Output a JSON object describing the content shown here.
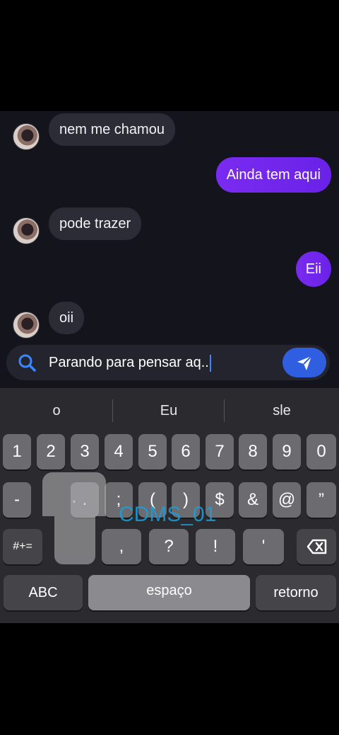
{
  "messages": [
    {
      "side": "in",
      "text": "nem me chamou"
    },
    {
      "side": "out",
      "text": "Ainda tem aqui"
    },
    {
      "side": "in",
      "text": "pode trazer"
    },
    {
      "side": "out",
      "text": "Eii"
    },
    {
      "side": "in",
      "text": "oii"
    }
  ],
  "composer": {
    "text": "Parando para pensar aq.."
  },
  "keyboard": {
    "suggestions": [
      "o",
      "Eu",
      "sle"
    ],
    "row1": [
      "1",
      "2",
      "3",
      "4",
      "5",
      "6",
      "7",
      "8",
      "9",
      "0"
    ],
    "row2": [
      "-",
      ".",
      ";",
      "(",
      ")",
      "$",
      "&",
      "@",
      "”"
    ],
    "row3": [
      "#+=",
      ",",
      "?",
      "!",
      "'"
    ],
    "abc": "ABC",
    "space": "espaço",
    "return": "retorno",
    "popup_char": "."
  },
  "watermark": "CDMS_01",
  "colors": {
    "outgoing": "#7a2bf0",
    "send": "#2f5fe0",
    "keyboard": "#2b2b2f"
  }
}
